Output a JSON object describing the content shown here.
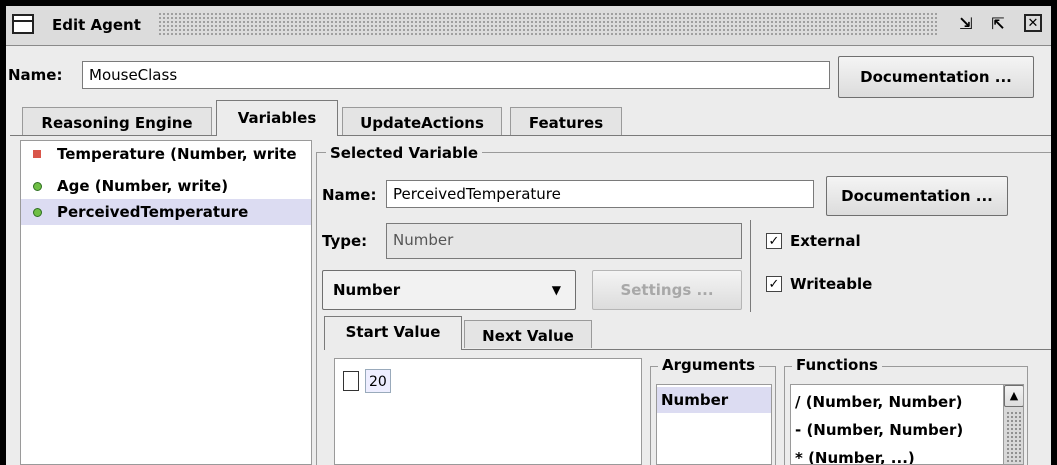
{
  "window": {
    "title": "Edit Agent",
    "buttons": [
      "restore-icon",
      "maximize-icon",
      "close-icon"
    ]
  },
  "agent": {
    "name_label": "Name:",
    "name_value": "MouseClass",
    "doc_button": "Documentation ..."
  },
  "tabs": [
    {
      "label": "Reasoning Engine",
      "active": false
    },
    {
      "label": "Variables",
      "active": true
    },
    {
      "label": "UpdateActions",
      "active": false
    },
    {
      "label": "Features",
      "active": false
    }
  ],
  "variables": [
    {
      "label": "Temperature (Number, write",
      "marker": "square",
      "color": "#d9564a",
      "selected": false
    },
    {
      "label": "Age (Number, write)",
      "marker": "circle",
      "color": "#6fbf45",
      "selected": false
    },
    {
      "label": "PerceivedTemperature",
      "marker": "circle",
      "color": "#6fbf45",
      "selected": true
    }
  ],
  "selected": {
    "group_title": "Selected Variable",
    "name_label": "Name:",
    "name_value": "PerceivedTemperature",
    "doc_button": "Documentation ...",
    "type_label": "Type:",
    "type_value": "Number",
    "type_select": "Number",
    "settings_button": "Settings ...",
    "external_label": "External",
    "external_checked": true,
    "writeable_label": "Writeable",
    "writeable_checked": true
  },
  "value_tabs": [
    {
      "label": "Start Value",
      "active": true
    },
    {
      "label": "Next Value",
      "active": false
    }
  ],
  "start_value": {
    "node_text": "20",
    "arguments_title": "Arguments",
    "arguments": [
      "Number"
    ],
    "functions_title": "Functions",
    "functions": [
      "/  (Number, Number)",
      "-  (Number, Number)",
      "*  (Number, ...)"
    ]
  }
}
